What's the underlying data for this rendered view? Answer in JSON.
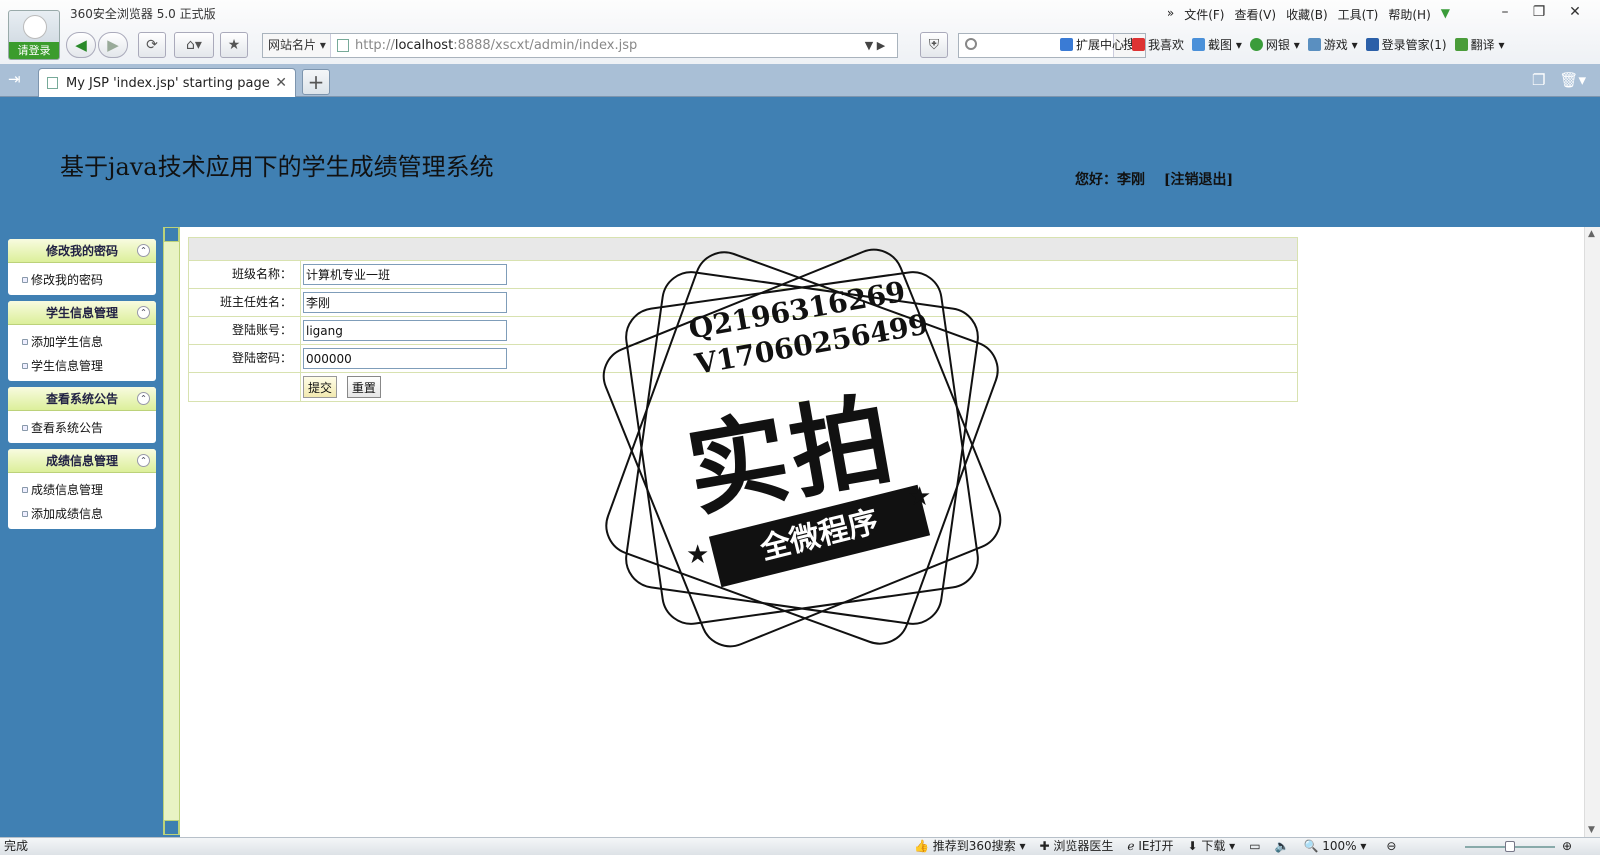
{
  "browser": {
    "app_title": "360安全浏览器 5.0 正式版",
    "login_label": "请登录",
    "menus": [
      "文件(F)",
      "查看(V)",
      "收藏(B)",
      "工具(T)",
      "帮助(H)"
    ],
    "site_dropdown": "网站名片",
    "url_prefix": "http://",
    "url_host": "localhost",
    "url_rest": ":8888/xscxt/admin/index.jsp",
    "search_button": "搜",
    "extensions": [
      "扩展中心",
      "我喜欢",
      "截图",
      "网银",
      "游戏",
      "登录管家(1)",
      "翻译"
    ],
    "tab_title": "My JSP 'index.jsp' starting page"
  },
  "header": {
    "title": "基于java技术应用下的学生成绩管理系统",
    "greeting": "您好：李刚",
    "logout": "[注销退出]"
  },
  "sidebar": {
    "groups": [
      {
        "title": "修改我的密码",
        "items": [
          "修改我的密码"
        ]
      },
      {
        "title": "学生信息管理",
        "items": [
          "添加学生信息",
          "学生信息管理"
        ]
      },
      {
        "title": "查看系统公告",
        "items": [
          "查看系统公告"
        ]
      },
      {
        "title": "成绩信息管理",
        "items": [
          "成绩信息管理",
          "添加成绩信息"
        ]
      }
    ]
  },
  "form": {
    "fields": [
      {
        "label": "班级名称：",
        "value": "计算机专业一班"
      },
      {
        "label": "班主任姓名：",
        "value": "李刚"
      },
      {
        "label": "登陆账号：",
        "value": "ligang"
      },
      {
        "label": "登陆密码：",
        "value": "000000"
      }
    ],
    "submit_label": "提交",
    "reset_label": "重置"
  },
  "watermark": {
    "line1": "Q2196316269",
    "line2": "V17060256499",
    "big": "实拍",
    "ribbon": "全微程序"
  },
  "status": {
    "left": "完成",
    "items": [
      "推荐到360搜索",
      "浏览器医生",
      "IE打开",
      "下载",
      "100%"
    ]
  }
}
